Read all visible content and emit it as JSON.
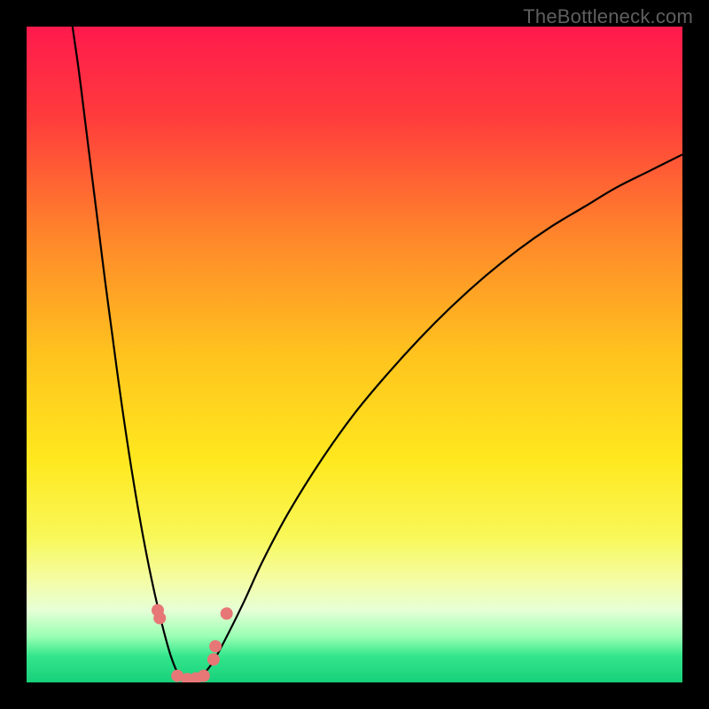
{
  "watermark": "TheBottleneck.com",
  "chart_data": {
    "type": "line",
    "title": "",
    "xlabel": "",
    "ylabel": "",
    "x_range": [
      0,
      100
    ],
    "y_range": [
      0,
      100
    ],
    "minimum_x": 24,
    "gradient_stops": [
      {
        "offset": 0.0,
        "color": "#ff1a4d"
      },
      {
        "offset": 0.14,
        "color": "#ff3c3c"
      },
      {
        "offset": 0.33,
        "color": "#ff8a2a"
      },
      {
        "offset": 0.5,
        "color": "#ffc31e"
      },
      {
        "offset": 0.66,
        "color": "#ffe81e"
      },
      {
        "offset": 0.78,
        "color": "#f8f85a"
      },
      {
        "offset": 0.84,
        "color": "#f5fca0"
      },
      {
        "offset": 0.89,
        "color": "#e6ffd6"
      },
      {
        "offset": 0.93,
        "color": "#99ffb3"
      },
      {
        "offset": 0.96,
        "color": "#33e68c"
      },
      {
        "offset": 1.0,
        "color": "#17d07a"
      }
    ],
    "series": [
      {
        "name": "left-branch",
        "points": [
          {
            "x": 7.0,
            "y": 100.0
          },
          {
            "x": 8.0,
            "y": 93.0
          },
          {
            "x": 9.0,
            "y": 85.0
          },
          {
            "x": 10.0,
            "y": 77.0
          },
          {
            "x": 11.0,
            "y": 69.0
          },
          {
            "x": 12.0,
            "y": 61.0
          },
          {
            "x": 13.0,
            "y": 53.5
          },
          {
            "x": 14.0,
            "y": 46.0
          },
          {
            "x": 15.0,
            "y": 39.0
          },
          {
            "x": 16.0,
            "y": 32.5
          },
          {
            "x": 17.0,
            "y": 26.5
          },
          {
            "x": 18.0,
            "y": 21.0
          },
          {
            "x": 19.0,
            "y": 16.0
          },
          {
            "x": 20.0,
            "y": 11.5
          },
          {
            "x": 21.0,
            "y": 7.5
          },
          {
            "x": 22.0,
            "y": 4.0
          },
          {
            "x": 23.0,
            "y": 1.5
          },
          {
            "x": 24.0,
            "y": 0.0
          }
        ]
      },
      {
        "name": "right-branch",
        "points": [
          {
            "x": 24.0,
            "y": 0.0
          },
          {
            "x": 26.0,
            "y": 0.5
          },
          {
            "x": 28.0,
            "y": 2.5
          },
          {
            "x": 30.0,
            "y": 6.0
          },
          {
            "x": 33.0,
            "y": 12.0
          },
          {
            "x": 36.0,
            "y": 18.5
          },
          {
            "x": 40.0,
            "y": 26.0
          },
          {
            "x": 45.0,
            "y": 34.0
          },
          {
            "x": 50.0,
            "y": 41.0
          },
          {
            "x": 55.0,
            "y": 47.0
          },
          {
            "x": 60.0,
            "y": 52.5
          },
          {
            "x": 65.0,
            "y": 57.5
          },
          {
            "x": 70.0,
            "y": 62.0
          },
          {
            "x": 75.0,
            "y": 66.0
          },
          {
            "x": 80.0,
            "y": 69.5
          },
          {
            "x": 85.0,
            "y": 72.5
          },
          {
            "x": 90.0,
            "y": 75.5
          },
          {
            "x": 95.0,
            "y": 78.0
          },
          {
            "x": 100.0,
            "y": 80.5
          }
        ]
      }
    ],
    "scatter": [
      {
        "x": 20.0,
        "y": 11.0
      },
      {
        "x": 20.3,
        "y": 9.8
      },
      {
        "x": 23.0,
        "y": 1.0
      },
      {
        "x": 24.5,
        "y": 0.5
      },
      {
        "x": 25.8,
        "y": 0.6
      },
      {
        "x": 27.0,
        "y": 1.0
      },
      {
        "x": 28.5,
        "y": 3.5
      },
      {
        "x": 28.8,
        "y": 5.5
      },
      {
        "x": 30.5,
        "y": 10.5
      }
    ],
    "scatter_color": "#e77676",
    "scatter_radius": 7,
    "line_color": "#000000",
    "line_width": 2.2
  }
}
